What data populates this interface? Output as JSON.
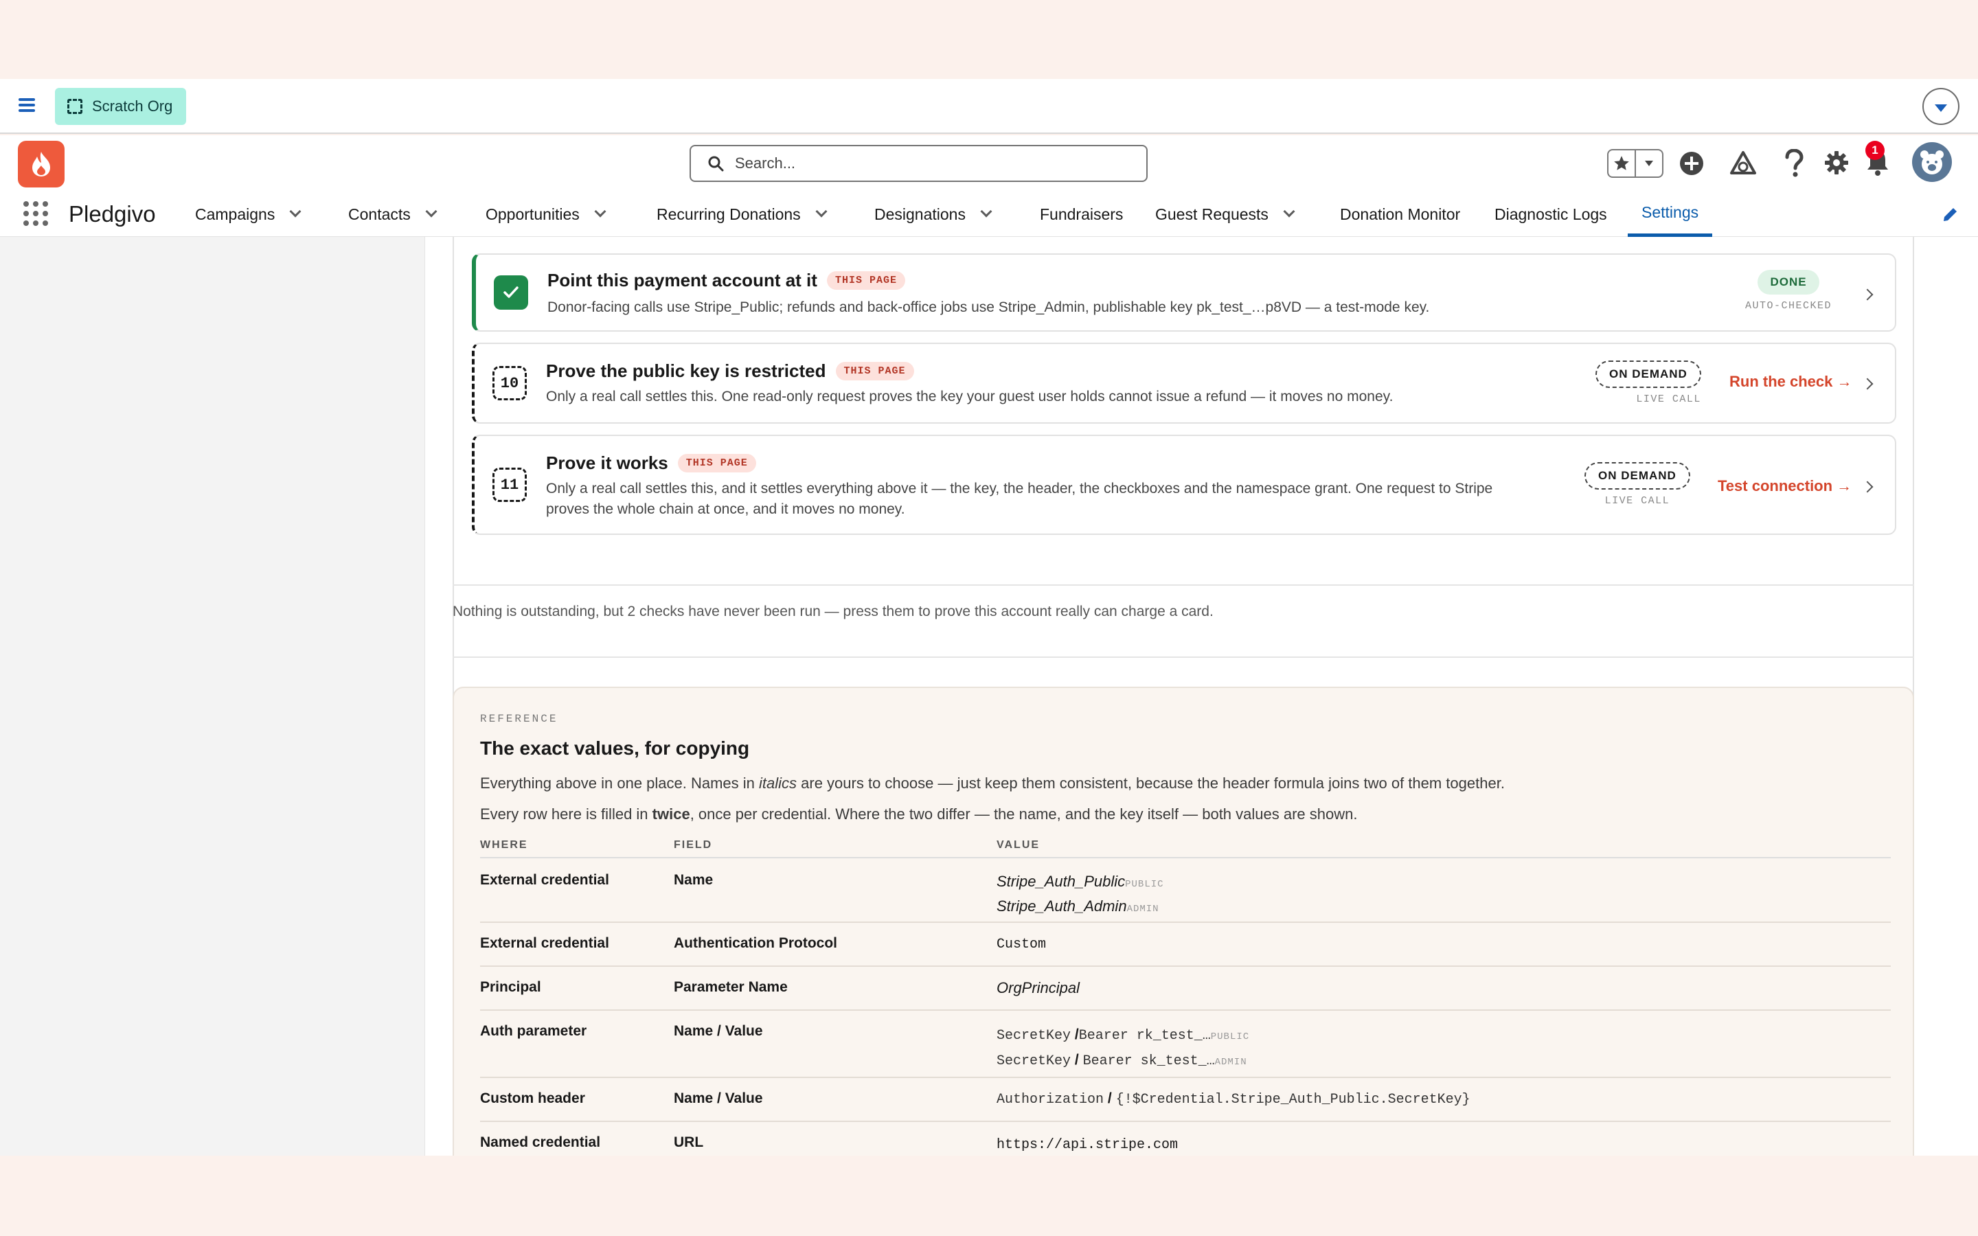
{
  "top_bar": {
    "org_label": "Scratch Org"
  },
  "header": {
    "search_placeholder": "Search...",
    "notification_count": "1"
  },
  "nav": {
    "app_name": "Pledgivo",
    "items": [
      {
        "label": "Campaigns",
        "dropdown": true
      },
      {
        "label": "Contacts",
        "dropdown": true
      },
      {
        "label": "Opportunities",
        "dropdown": true
      },
      {
        "label": "Recurring Donations",
        "dropdown": true
      },
      {
        "label": "Designations",
        "dropdown": true
      },
      {
        "label": "Fundraisers",
        "dropdown": false
      },
      {
        "label": "Guest Requests",
        "dropdown": true
      },
      {
        "label": "Donation Monitor",
        "dropdown": false
      },
      {
        "label": "Diagnostic Logs",
        "dropdown": false
      },
      {
        "label": "Settings",
        "dropdown": false,
        "active": true
      }
    ]
  },
  "steps": [
    {
      "title": "Point this payment account at it",
      "tag": "THIS PAGE",
      "description": "Donor-facing calls use Stripe_Public; refunds and back-office jobs use Stripe_Admin, publishable key pk_test_…p8VD — a test-mode key.",
      "status": "DONE",
      "status_sub": "AUTO-CHECKED"
    },
    {
      "number": "10",
      "title": "Prove the public key is restricted",
      "tag": "THIS PAGE",
      "description": "Only a real call settles this. One read-only request proves the key your guest user holds cannot issue a refund — it moves no money.",
      "status": "ON DEMAND",
      "status_sub": "LIVE CALL",
      "action": "Run the check →"
    },
    {
      "number": "11",
      "title": "Prove it works",
      "tag": "THIS PAGE",
      "description_line1": "Only a real call settles this, and it settles everything above it — the key, the header, the checkboxes and the namespace grant. One request to Stripe",
      "description_line2": "proves the whole chain at once, and it moves no money.",
      "status": "ON DEMAND",
      "status_sub": "LIVE CALL",
      "action": "Test connection →"
    }
  ],
  "summary": "Nothing is outstanding, but 2 checks have never been run — press them to prove this account really can charge a card.",
  "reference": {
    "eyebrow": "REFERENCE",
    "title": "The exact values, for copying",
    "p1_a": "Everything above in one place. Names in ",
    "p1_italic": "italics",
    "p1_b": " are yours to choose — just keep them consistent, because the header formula joins two of them together.",
    "p2_a": "Every row here is filled in ",
    "p2_bold": "twice",
    "p2_b": ", once per credential. Where the two differ — the name, and the key itself — both values are shown.",
    "columns": {
      "where": "WHERE",
      "field": "FIELD",
      "value": "VALUE"
    },
    "rows": [
      {
        "where": "External credential",
        "field": "Name",
        "v1": "Stripe_Auth_Public",
        "v1_tag": "PUBLIC",
        "v2": "Stripe_Auth_Admin",
        "v2_tag": "ADMIN"
      },
      {
        "where": "External credential",
        "field": "Authentication Protocol",
        "value": "Custom"
      },
      {
        "where": "Principal",
        "field": "Parameter Name",
        "value": "OrgPrincipal"
      },
      {
        "where": "Auth parameter",
        "field": "Name / Value",
        "v1a": "SecretKey",
        "v1b": "Bearer rk_test_…",
        "v1_tag": "PUBLIC",
        "v2a": "SecretKey",
        "v2b": "Bearer sk_test_…",
        "v2_tag": "ADMIN"
      },
      {
        "where": "Custom header",
        "field": "Name / Value",
        "va": "Authorization",
        "vb": "{!$Credential.Stripe_Auth_Public.SecretKey}"
      },
      {
        "where": "Named credential",
        "field": "URL",
        "value": "https://api.stripe.com"
      }
    ]
  }
}
